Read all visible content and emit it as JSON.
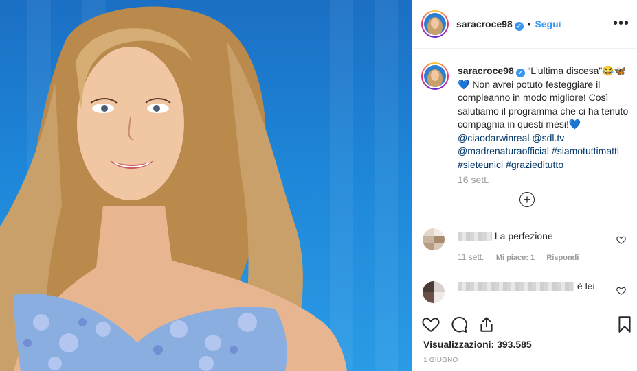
{
  "post": {
    "username": "saracroce98",
    "verified_mark": "✓",
    "dot": "•",
    "follow_label": "Segui",
    "more_label": "•••"
  },
  "caption": {
    "username": "saracroce98",
    "lead": "“L'ultima discesa”😂🦋",
    "body": "💙 Non avrei potuto festeggiare il compleanno in modo migliore! Così salutiamo il programma che ci ha tenuto compagnia in questi mesi!💙",
    "mention_1": "@ciaodarwinreal",
    "mention_2": "@sdl.tv",
    "mention_3": "@madrenaturaofficial",
    "hashtag_1": "#siamotuttimatti",
    "hashtag_2": "#sieteunici",
    "hashtag_3": "#grazieditutto",
    "time": "16 sett."
  },
  "load_more_symbol": "+",
  "comments": [
    {
      "text": "La perfezione",
      "time": "11 sett.",
      "likes_label": "Mi piace: 1",
      "reply_label": "Rispondi"
    },
    {
      "text": "è lei"
    }
  ],
  "footer": {
    "views_label": "Visualizzazioni: 393.585",
    "date": "1 GIUGNO"
  },
  "colors": {
    "accent": "#3897f0",
    "link": "#003569",
    "muted": "#999999",
    "media_blue": "#1e86d8"
  },
  "icons": {
    "like": "heart-icon",
    "comment": "comment-icon",
    "share": "share-icon",
    "save": "bookmark-icon",
    "more": "more-options-icon",
    "load_more": "plus-circle-icon"
  }
}
